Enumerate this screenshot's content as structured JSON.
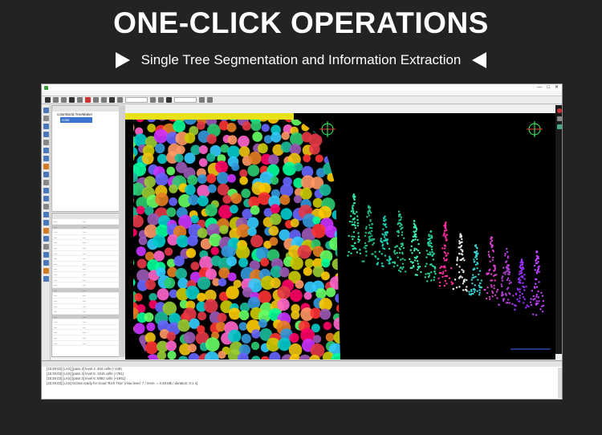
{
  "banner": {
    "title": "ONE-CLICK OPERATIONS",
    "subtitle": "Single Tree Segmentation and Information Extraction"
  },
  "app": {
    "window_controls": [
      "—",
      "□",
      "✕"
    ],
    "toolbar_icons": [
      "open-icon",
      "save-icon",
      "hand-icon",
      "rotate-icon",
      "zoom-icon",
      "select-icon",
      "measure-icon",
      "segment-icon",
      "color-icon",
      "settings-icon"
    ],
    "db_panel": {
      "items": [
        {
          "label": "colorWorld TreeMaker"
        },
        {
          "label": "color"
        }
      ]
    },
    "properties": [
      {
        "k": "—",
        "v": "—",
        "section": false
      },
      {
        "k": "—",
        "v": "—",
        "section": true
      },
      {
        "k": "—",
        "v": "—",
        "section": false
      },
      {
        "k": "—",
        "v": "—",
        "section": false
      },
      {
        "k": "—",
        "v": "—",
        "section": false
      },
      {
        "k": "—",
        "v": "—",
        "section": false
      },
      {
        "k": "—",
        "v": "—",
        "section": false
      },
      {
        "k": "—",
        "v": "—",
        "section": false
      },
      {
        "k": "—",
        "v": "—",
        "section": false
      },
      {
        "k": "—",
        "v": "—",
        "section": false
      },
      {
        "k": "—",
        "v": "—",
        "section": false
      },
      {
        "k": "—",
        "v": "—",
        "section": false
      },
      {
        "k": "—",
        "v": "—",
        "section": false
      },
      {
        "k": "—",
        "v": "—",
        "section": true
      },
      {
        "k": "—",
        "v": "—",
        "section": false
      },
      {
        "k": "—",
        "v": "—",
        "section": false
      },
      {
        "k": "—",
        "v": "—",
        "section": false
      },
      {
        "k": "—",
        "v": "—",
        "section": false
      },
      {
        "k": "—",
        "v": "—",
        "section": true
      },
      {
        "k": "—",
        "v": "—",
        "section": false
      },
      {
        "k": "—",
        "v": "—",
        "section": false
      },
      {
        "k": "—",
        "v": "—",
        "section": false
      },
      {
        "k": "—",
        "v": "—",
        "section": false
      },
      {
        "k": "—",
        "v": "—",
        "section": false
      }
    ],
    "console_lines": [
      "[15:29:03] [LAS] [pass 2] level 4: 404 cells (+149)",
      "[15:29:03] [LAS] [pass 2] level 5: 1515 cells (+781)",
      "[15:29:03] [LAS] [pass 2] level 6: 5992 cells (+1951)",
      "[15:29:03] [LAS] Octree ready for cloud 'Rich Tree' (max level: 7 / mem. = 0.48 Mb / duration: 0.1 s)"
    ]
  }
}
